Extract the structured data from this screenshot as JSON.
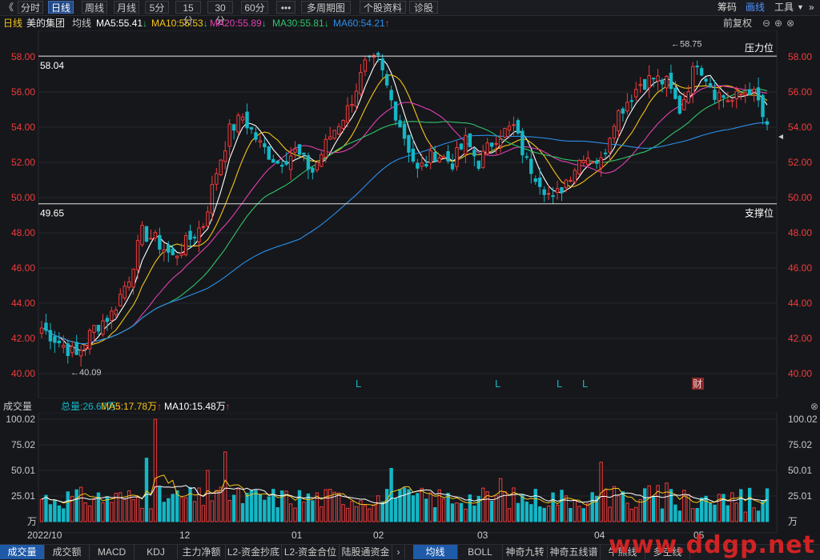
{
  "toolbar": {
    "back": "《",
    "items": [
      "分时",
      "日线",
      "周线",
      "月线",
      "5分",
      "15分",
      "30分",
      "60分",
      "•••",
      "多周期图",
      "个股资料",
      "诊股"
    ],
    "active_index": 1,
    "right_items": [
      "筹码",
      "画线",
      "工具"
    ],
    "right_active": 1
  },
  "legend": {
    "period": "日线",
    "stock_name": "美的集团",
    "ma_label": "均线",
    "ma5": "MA5:55.41",
    "ma10": "MA10:55.53",
    "ma20": "MA20:55.89",
    "ma30": "MA30:55.81",
    "ma60": "MA60:54.21",
    "adjust": "前复权"
  },
  "colors": {
    "up": "#f23b3b",
    "down": "#14b7c6",
    "ma5": "#ffffff",
    "ma10": "#f5c518",
    "ma20": "#e040b0",
    "ma30": "#2ec66a",
    "ma60": "#2b8ee8",
    "accent": "#1f5aa8"
  },
  "main_chart": {
    "y_labels": [
      "58.00",
      "56.00",
      "54.00",
      "52.00",
      "50.00",
      "48.00",
      "46.00",
      "44.00",
      "42.00",
      "40.00"
    ],
    "y_values": [
      58,
      56,
      54,
      52,
      50,
      48,
      46,
      44,
      42,
      40
    ],
    "resistance_value": "58.04",
    "resistance_label": "压力位",
    "support_value": "49.65",
    "support_label": "支撑位",
    "high_mark": "58.75",
    "low_mark": "40.09",
    "markers": [
      "L",
      "L",
      "L",
      "L"
    ],
    "event_marker": "财"
  },
  "volume_chart": {
    "title": "成交量",
    "total": "总量:26.67万",
    "ma5": "MA5:17.78万",
    "ma10": "MA10:15.48万",
    "y_labels": [
      "100.02",
      "75.02",
      "50.01",
      "25.01"
    ],
    "unit": "万"
  },
  "x_axis": [
    "2022/10",
    "12",
    "01",
    "02",
    "03",
    "04",
    "05"
  ],
  "bottom_tabs": [
    "成交量",
    "成交额",
    "MACD",
    "KDJ",
    "主力净额",
    "L2-资金抄底",
    "L2-资金合位",
    "陆股通资金",
    "均线",
    "BOLL",
    "神奇九转",
    "神奇五线谱",
    "牛熊线",
    "多空线"
  ],
  "bottom_active": [
    0,
    8
  ],
  "watermark": "www.ddgp.net"
}
